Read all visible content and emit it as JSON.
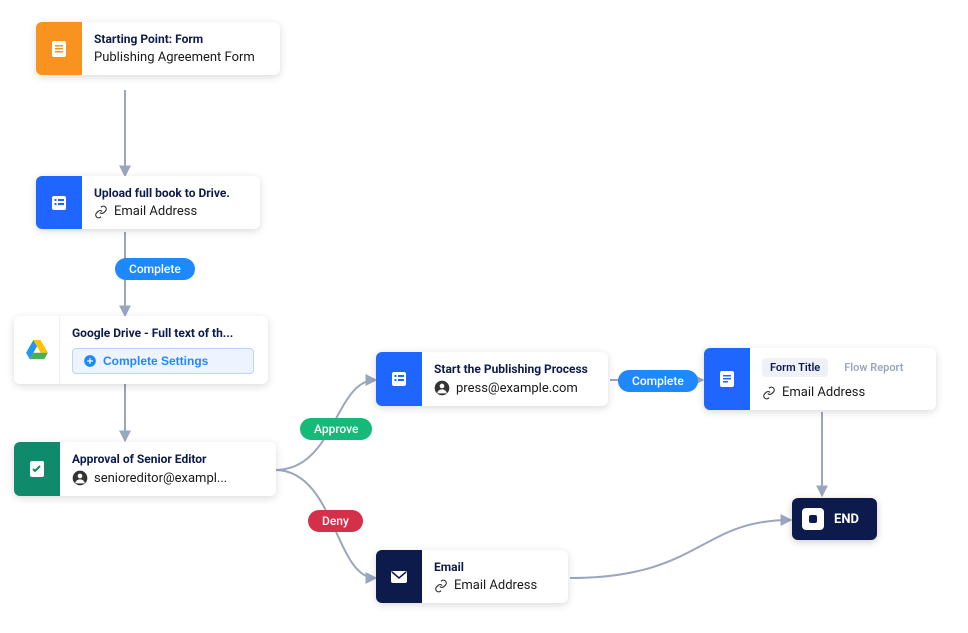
{
  "nodes": {
    "start": {
      "title": "Starting Point: Form",
      "subtitle": "Publishing Agreement Form"
    },
    "upload": {
      "title": "Upload full book to Drive.",
      "link_label": "Email Address"
    },
    "drive": {
      "title": "Google Drive - Full text of th...",
      "button": "Complete Settings"
    },
    "approval": {
      "title": "Approval of Senior Editor",
      "user": "senioreditor@exampl..."
    },
    "publish": {
      "title": "Start the Publishing Process",
      "user": "press@example.com"
    },
    "email": {
      "title": "Email",
      "link_label": "Email Address"
    },
    "report": {
      "tag_active": "Form Title",
      "tag_dim": "Flow Report",
      "link_label": "Email Address"
    },
    "end": {
      "label": "END"
    }
  },
  "badges": {
    "complete1": "Complete",
    "approve": "Approve",
    "deny": "Deny",
    "complete2": "Complete"
  }
}
